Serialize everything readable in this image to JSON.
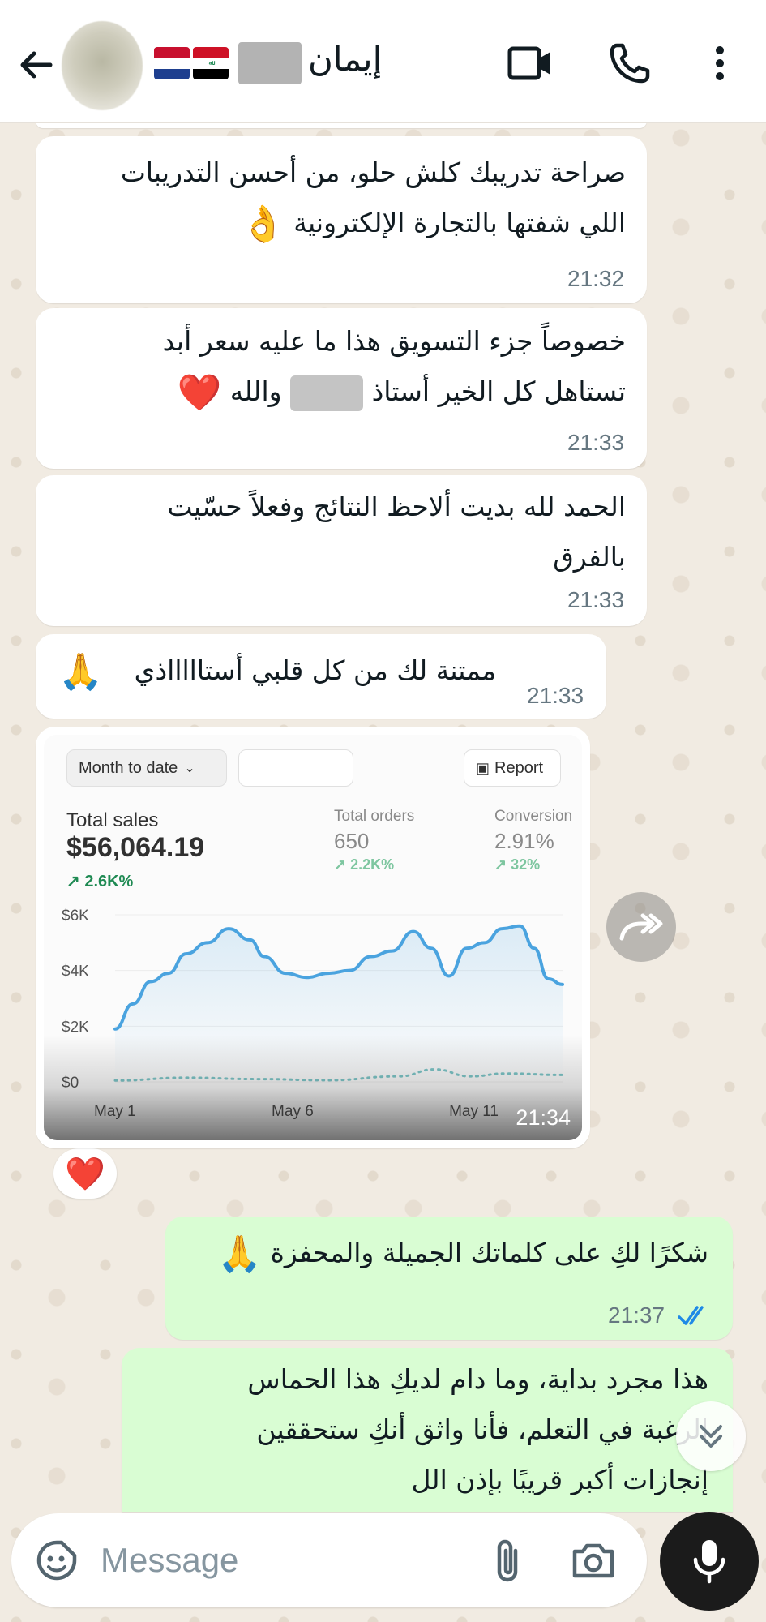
{
  "header": {
    "contact_name": "إيمان",
    "flags": [
      "netherlands",
      "iraq"
    ],
    "icons": [
      "back-arrow-icon",
      "video-call-icon",
      "phone-icon",
      "more-vert-icon"
    ]
  },
  "messages": [
    {
      "direction": "in",
      "lines": [
        "صراحة تدريبك كلش حلو، من أحسن التدريبات",
        "اللي شفتها بالتجارة الإلكترونية"
      ],
      "emoji": "👌",
      "time": "21:32"
    },
    {
      "direction": "in",
      "lines": [
        "خصوصاً جزء التسويق هذا ما عليه سعر أبد",
        "تستاهل كل الخير أستاذ",
        "والله"
      ],
      "emoji": "❤️",
      "time": "21:33"
    },
    {
      "direction": "in",
      "lines": [
        "الحمد لله بديت ألاحظ النتائج وفعلاً حسّيت",
        "بالفرق"
      ],
      "time": "21:33"
    },
    {
      "direction": "in",
      "lines": [
        "ممتنة لك من كل قلبي أستاااااذي"
      ],
      "emoji": "🙏",
      "time": "21:33"
    },
    {
      "direction": "out",
      "lines": [
        "شكرًا لكِ على كلماتك الجميلة والمحفزة"
      ],
      "emoji": "🙏",
      "time": "21:37",
      "status": "read"
    },
    {
      "direction": "out",
      "lines": [
        "هذا مجرد بداية، وما دام لديكِ هذا الحماس",
        "الرغبة في التعلم، فأنا واثق أنكِ ستحققين",
        "إنجازات أكبر قريبًا بإذن الل"
      ]
    }
  ],
  "image_message": {
    "time": "21:34",
    "reaction": "❤️",
    "screenshot": {
      "date_filter": "Month to date",
      "report_label": "Report",
      "total_sales_label": "Total sales",
      "total_sales_value": "$56,064.19",
      "total_sales_delta": "↗ 2.6K%",
      "total_orders_label": "Total orders",
      "total_orders_value": "650",
      "total_orders_delta": "↗ 2.2K%",
      "conversion_label": "Conversion",
      "conversion_value": "2.91%",
      "conversion_delta": "↗ 32%"
    }
  },
  "chart_data": {
    "type": "line",
    "title": "",
    "xlabel": "",
    "ylabel": "",
    "y_tick_labels": [
      "$6K",
      "$4K",
      "$2K",
      "$0"
    ],
    "y_ticks": [
      6000,
      4000,
      2000,
      0
    ],
    "x_tick_labels": [
      "May 1",
      "May 6",
      "May 11"
    ],
    "x_ticks": [
      1,
      6,
      11
    ],
    "ylim": [
      0,
      6000
    ],
    "xlim": [
      1,
      13.6
    ],
    "series": [
      {
        "name": "",
        "style": "solid",
        "color": "#4aa3df",
        "x": [
          1,
          1.5,
          2,
          2.5,
          3,
          3.6,
          4.2,
          4.8,
          5.2,
          5.8,
          6.4,
          7,
          7.6,
          8.2,
          8.8,
          9.4,
          9.9,
          10.4,
          10.9,
          11.4,
          11.9,
          12.4,
          12.8,
          13.2,
          13.6
        ],
        "y": [
          1900,
          2800,
          3600,
          3900,
          4600,
          5000,
          5500,
          5100,
          4500,
          3900,
          3750,
          3900,
          4000,
          4500,
          4700,
          5400,
          4800,
          3800,
          4800,
          5000,
          5500,
          5600,
          4800,
          3700,
          3500
        ]
      },
      {
        "name": "",
        "style": "dotted",
        "color": "#7ec6c8",
        "x": [
          1,
          3,
          5,
          7,
          9,
          10,
          11,
          12,
          13.6
        ],
        "y": [
          50,
          150,
          100,
          60,
          200,
          450,
          200,
          300,
          250
        ]
      }
    ],
    "grid": true
  },
  "composer": {
    "placeholder": "Message",
    "icons": [
      "sticker-icon",
      "attach-icon",
      "camera-icon",
      "mic-icon"
    ]
  }
}
